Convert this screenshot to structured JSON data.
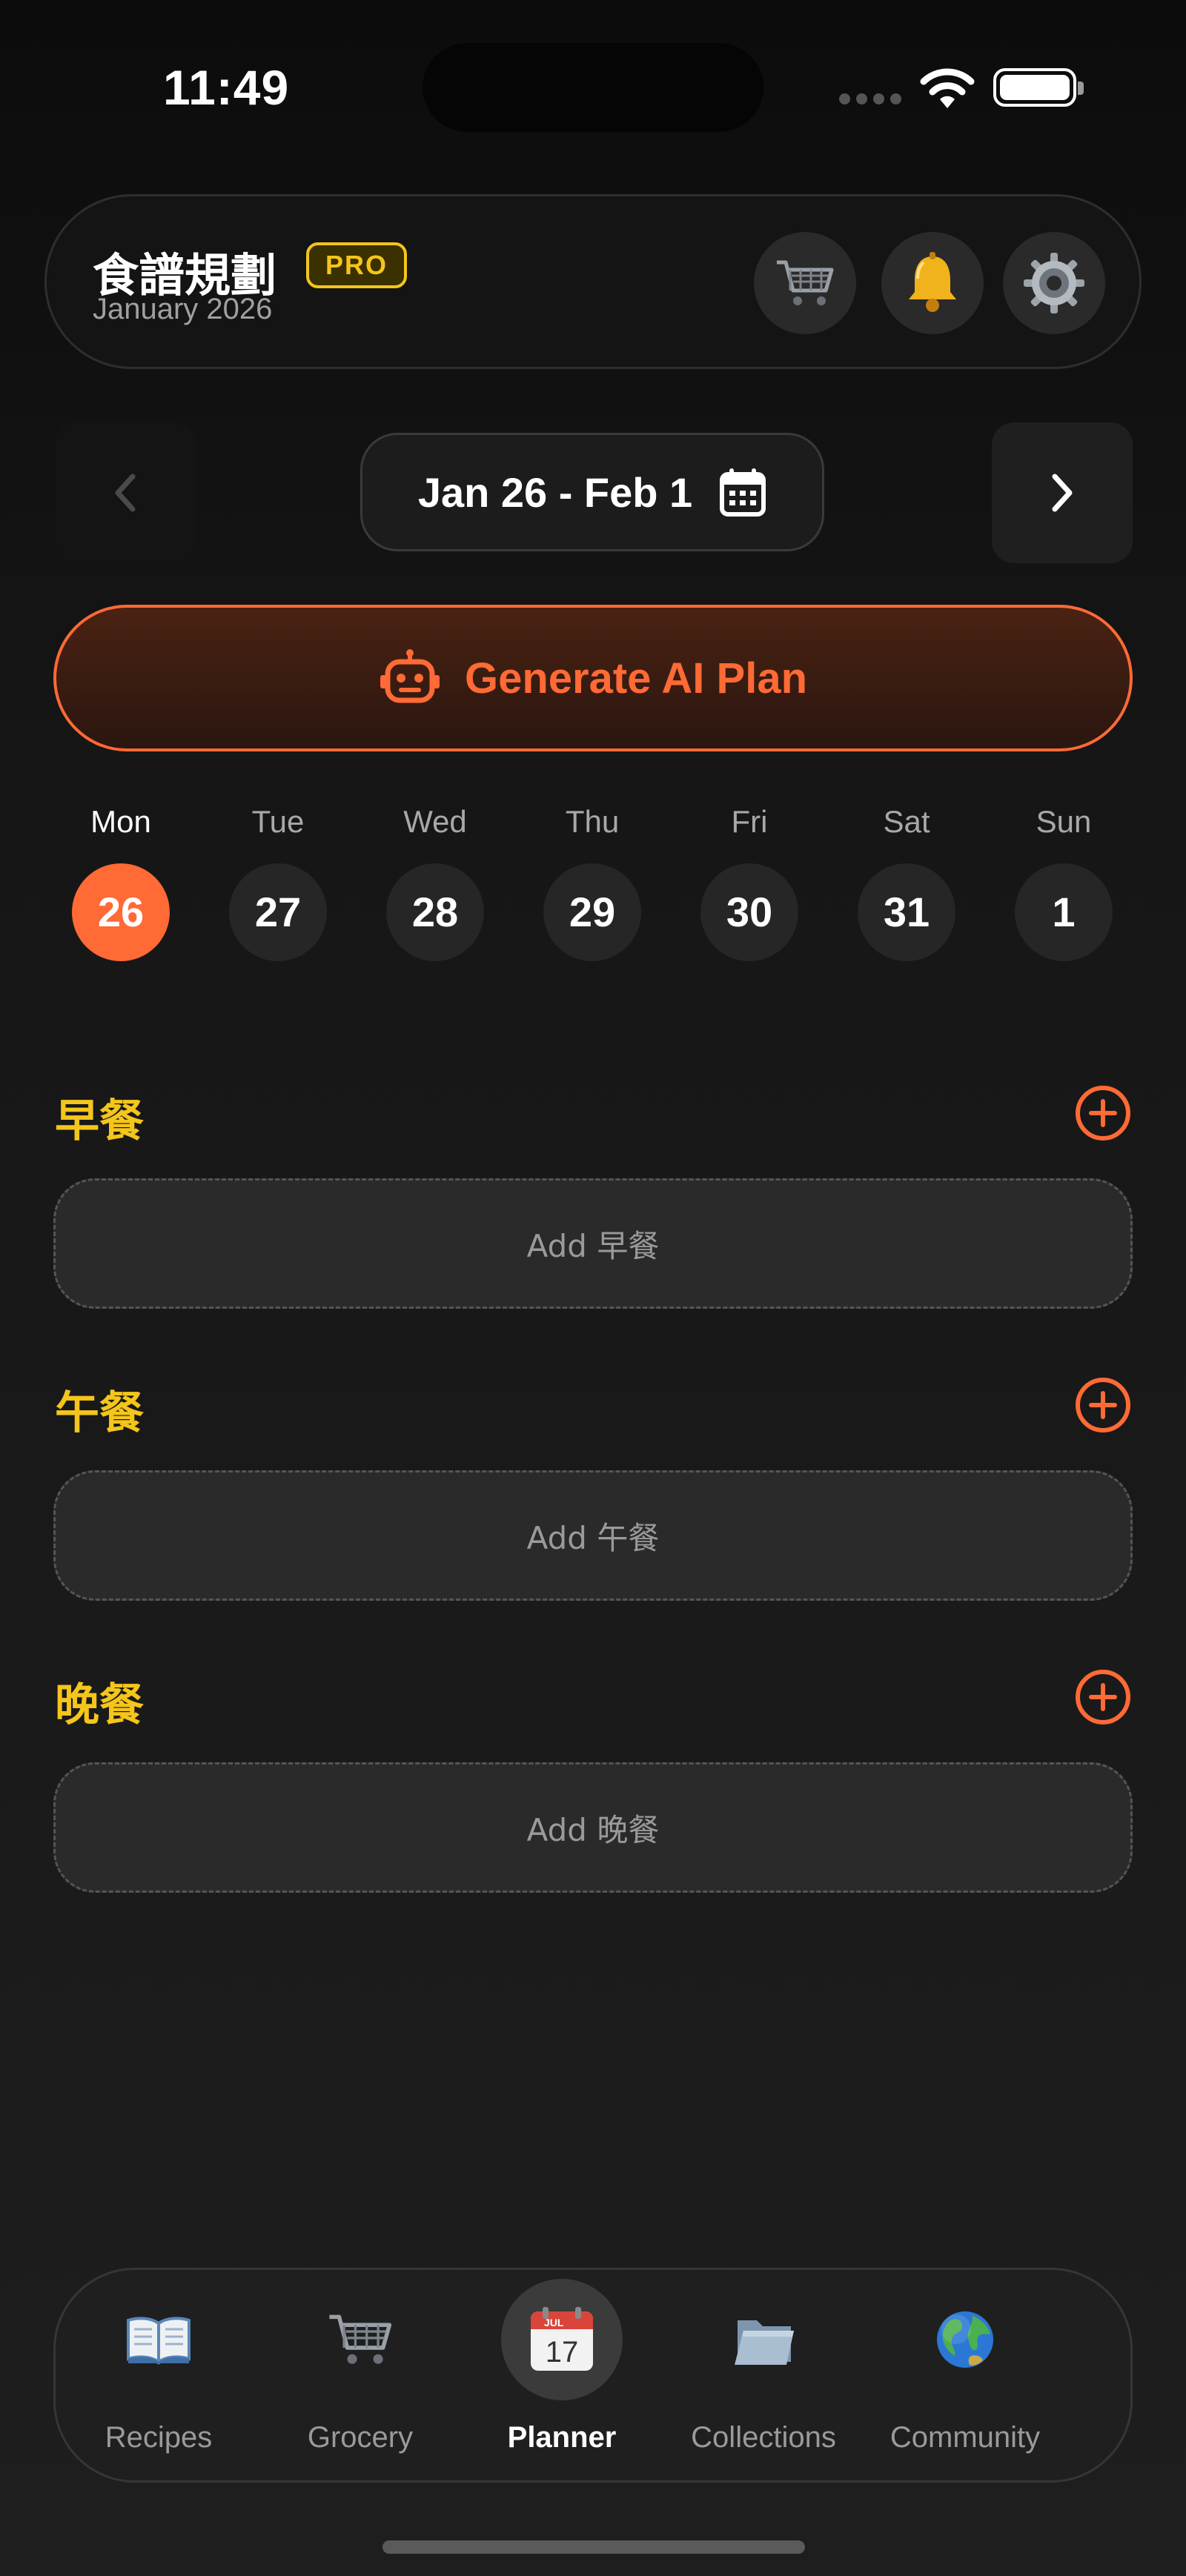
{
  "status_bar": {
    "time": "11:49"
  },
  "header": {
    "title": "食譜規劃",
    "badge": "PRO",
    "subtitle": "January 2026",
    "actions": [
      {
        "name": "cart-icon"
      },
      {
        "name": "bell-icon"
      },
      {
        "name": "gear-icon"
      }
    ]
  },
  "week_nav": {
    "range": "Jan 26 - Feb 1",
    "prev_icon": "chevron-left-icon",
    "next_icon": "chevron-right-icon",
    "calendar_icon": "calendar-icon"
  },
  "generate": {
    "label": "Generate AI Plan",
    "icon": "robot-icon"
  },
  "days": [
    {
      "name": "Mon",
      "num": "26",
      "active": true
    },
    {
      "name": "Tue",
      "num": "27",
      "active": false
    },
    {
      "name": "Wed",
      "num": "28",
      "active": false
    },
    {
      "name": "Thu",
      "num": "29",
      "active": false
    },
    {
      "name": "Fri",
      "num": "30",
      "active": false
    },
    {
      "name": "Sat",
      "num": "31",
      "active": false
    },
    {
      "name": "Sun",
      "num": "1",
      "active": false
    }
  ],
  "meals": [
    {
      "title": "早餐",
      "add_label": "Add 早餐"
    },
    {
      "title": "午餐",
      "add_label": "Add 午餐"
    },
    {
      "title": "晚餐",
      "add_label": "Add 晚餐"
    }
  ],
  "tabs": [
    {
      "label": "Recipes",
      "icon": "book-icon",
      "active": false
    },
    {
      "label": "Grocery",
      "icon": "cart-icon",
      "active": false
    },
    {
      "label": "Planner",
      "icon": "calendar-icon",
      "active": true,
      "calendar_month": "JUL",
      "calendar_day": "17"
    },
    {
      "label": "Collections",
      "icon": "folder-icon",
      "active": false
    },
    {
      "label": "Community",
      "icon": "globe-icon",
      "active": false
    }
  ],
  "colors": {
    "accent": "#ff6a35",
    "meal_title": "#f4c51b",
    "background": "#161616"
  }
}
